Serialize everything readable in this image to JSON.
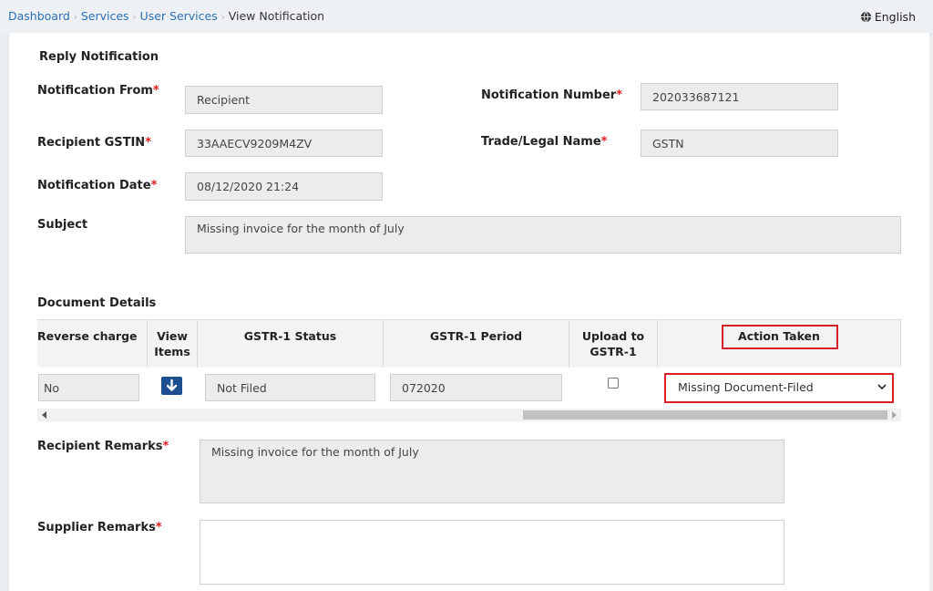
{
  "breadcrumb": [
    "Dashboard",
    "Services",
    "User Services",
    "View Notification"
  ],
  "language": "English",
  "section_title": "Reply Notification",
  "fields": {
    "notification_from": {
      "label": "Notification From",
      "value": "Recipient"
    },
    "notification_number": {
      "label": "Notification Number",
      "value": "202033687121"
    },
    "recipient_gstin": {
      "label": "Recipient GSTIN",
      "value": "33AAECV9209M4ZV"
    },
    "trade_legal_name": {
      "label": "Trade/Legal Name",
      "value": "GSTN"
    },
    "notification_date": {
      "label": "Notification Date",
      "value": "08/12/2020 21:24"
    },
    "subject": {
      "label": "Subject",
      "value": "Missing invoice for the month of July"
    }
  },
  "required_mark": "*",
  "document_details": {
    "title": "Document Details",
    "headers": {
      "reverse_charge": "Reverse charge",
      "view_items_1": "View",
      "view_items_2": "Items",
      "gstr1_status": "GSTR-1 Status",
      "gstr1_period": "GSTR-1 Period",
      "upload_1": "Upload to",
      "upload_2": "GSTR-1",
      "action_taken": "Action Taken"
    },
    "row": {
      "reverse_charge": "No",
      "gstr1_status": "Not Filed",
      "gstr1_period": "072020",
      "upload_checked": false,
      "action_taken": "Missing Document-Filed"
    }
  },
  "recipient_remarks": {
    "label": "Recipient Remarks",
    "value": "Missing invoice for the month of July"
  },
  "supplier_remarks": {
    "label": "Supplier Remarks",
    "value": ""
  },
  "icons": {
    "language": "globe-icon",
    "view_items": "arrow-down-icon",
    "dropdown": "chevron-down-icon"
  },
  "colors": {
    "link": "#2a6fb4",
    "required": "#e02020",
    "highlight": "#d81f26",
    "button": "#1d4f91"
  }
}
